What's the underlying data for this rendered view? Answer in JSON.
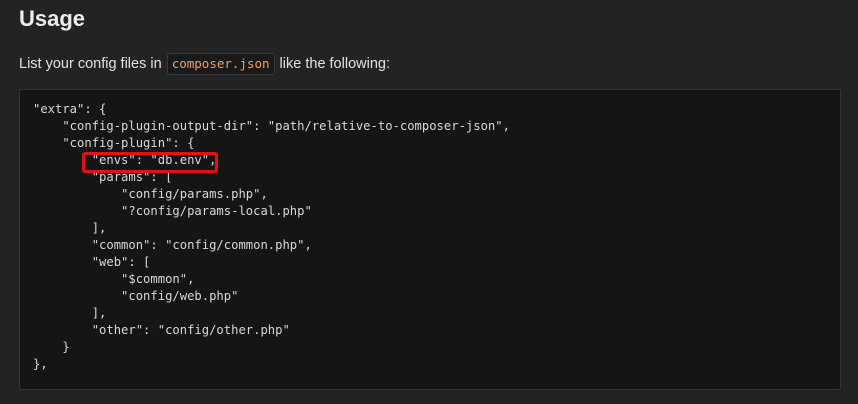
{
  "heading": "Usage",
  "intro": {
    "before": "List your config files in ",
    "code": "composer.json",
    "after": " like the following:"
  },
  "code_lines": [
    "\"extra\": {",
    "    \"config-plugin-output-dir\": \"path/relative-to-composer-json\",",
    "    \"config-plugin\": {",
    "        \"envs\": \"db.env\",",
    "        \"params\": [",
    "            \"config/params.php\",",
    "            \"?config/params-local.php\"",
    "        ],",
    "        \"common\": \"config/common.php\",",
    "        \"web\": [",
    "            \"$common\",",
    "            \"config/web.php\"",
    "        ],",
    "        \"other\": \"config/other.php\"",
    "    }",
    "},"
  ],
  "colors": {
    "page_background": "#222325",
    "code_background": "#151516",
    "inline_code_text": "#f0a060",
    "highlight_border": "#e3101a"
  }
}
